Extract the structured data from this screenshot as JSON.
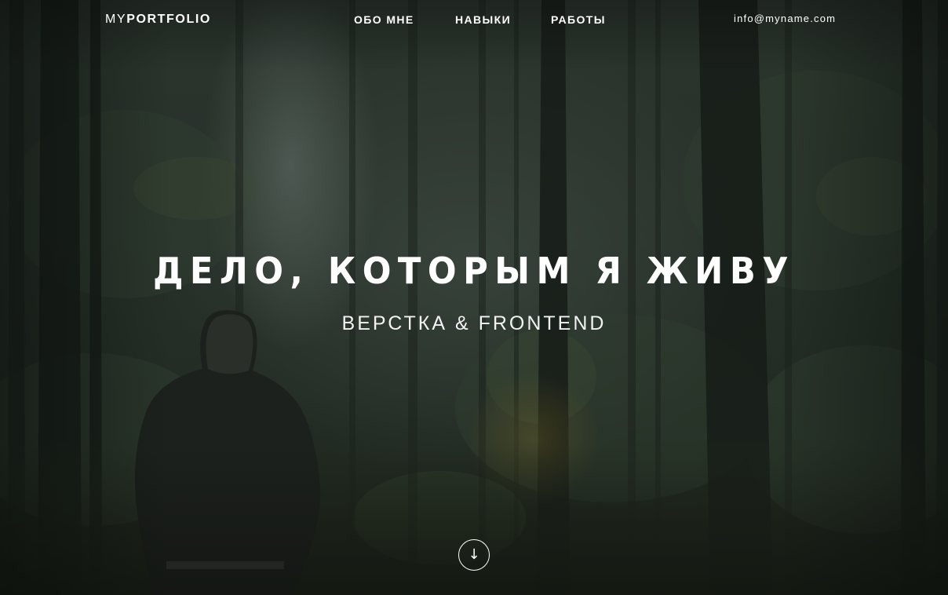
{
  "header": {
    "logo_light": "MY",
    "logo_bold": "PORTFOLIO",
    "nav": [
      {
        "label": "ОБО МНЕ"
      },
      {
        "label": "НАВЫКИ"
      },
      {
        "label": "РАБОТЫ"
      }
    ],
    "email": "info@myname.com"
  },
  "hero": {
    "title": "ДЕЛО, КОТОРЫМ Я ЖИВУ",
    "subtitle": "ВЕРСТКА & FRONTEND"
  },
  "scroll_button": {
    "icon": "arrow-down-icon",
    "glyph": "↓"
  },
  "colors": {
    "text": "#ffffff",
    "background_forest": "#27312a"
  }
}
